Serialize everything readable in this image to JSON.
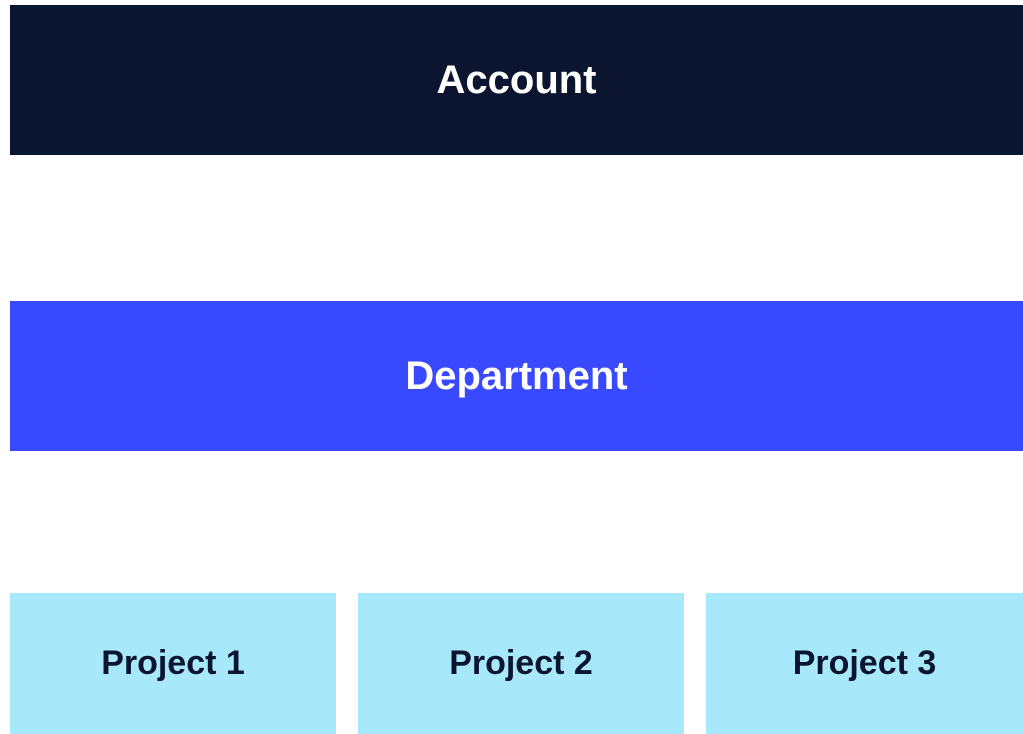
{
  "colors": {
    "account_bg": "#0b1530",
    "account_text": "#ffffff",
    "department_bg": "#3949ff",
    "department_text": "#ffffff",
    "project_bg": "#a8e8fb",
    "project_text": "#0b1530"
  },
  "hierarchy": {
    "account": {
      "label": "Account"
    },
    "department": {
      "label": "Department"
    },
    "projects": [
      {
        "label": "Project 1"
      },
      {
        "label": "Project 2"
      },
      {
        "label": "Project 3"
      }
    ]
  }
}
